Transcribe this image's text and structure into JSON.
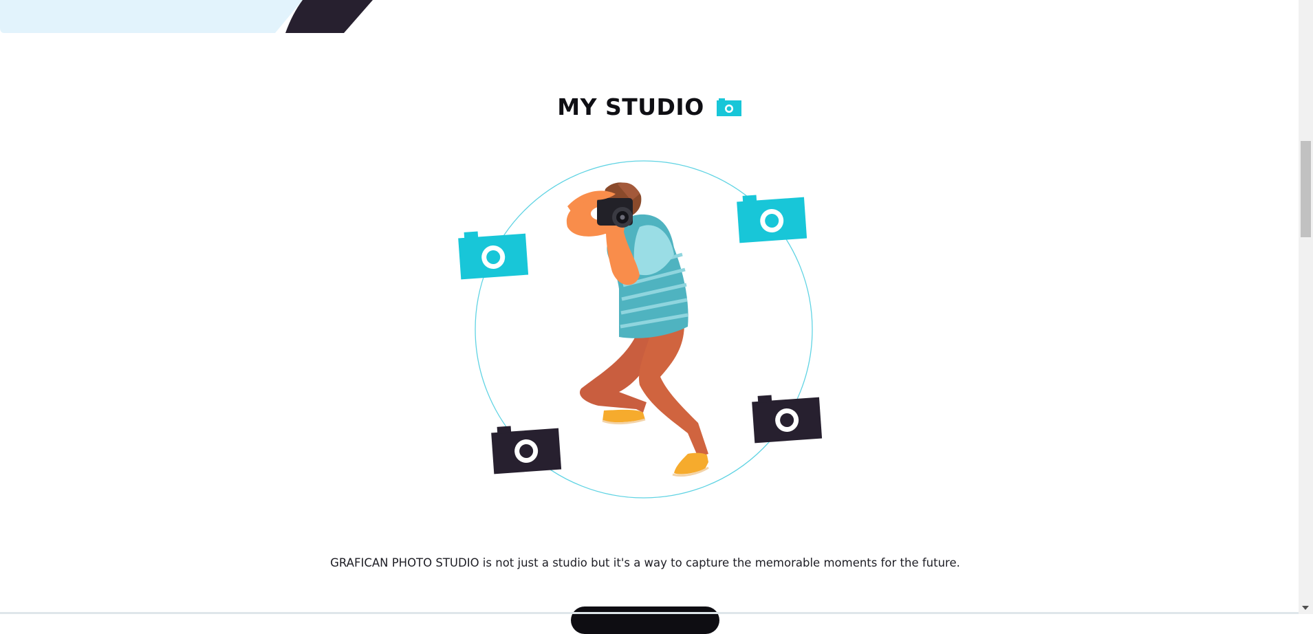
{
  "section": {
    "title": "MY STUDIO",
    "title_icon": "camera-icon",
    "tagline": "GRAFICAN PHOTO STUDIO is not just a studio but it's a way to capture the memorable moments for the future."
  },
  "illustration": {
    "subject": "photographer-illustration",
    "cameras": [
      {
        "icon": "camera-icon",
        "color": "#18c6d8"
      },
      {
        "icon": "camera-icon",
        "color": "#18c6d8"
      },
      {
        "icon": "camera-icon",
        "color": "#27202f"
      },
      {
        "icon": "camera-icon",
        "color": "#27202f"
      }
    ],
    "ring_color": "#5fd3e3"
  },
  "colors": {
    "accent": "#18c6d8",
    "dark": "#27202f",
    "banner": "#e2f3fc"
  }
}
